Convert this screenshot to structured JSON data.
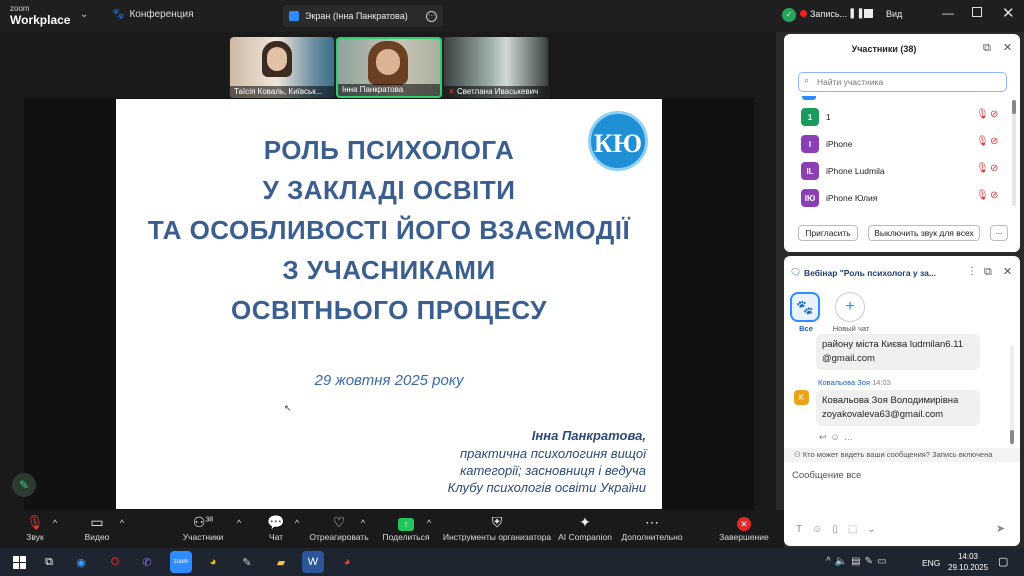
{
  "app": {
    "logo_small": "zoom",
    "logo_big": "Workplace",
    "conference_label": "Конференция",
    "screen_share_label": "Экран (Інна Панкратова)",
    "record_label": "Запись...",
    "view_label": "Вид"
  },
  "videos": [
    {
      "name": "Таїсія Коваль, Київськ..."
    },
    {
      "name": "Інна Панкратова"
    },
    {
      "name": "Светлана Иваськевич"
    }
  ],
  "slide": {
    "title_lines": [
      "РОЛЬ ПСИХОЛОГА",
      "У ЗАКЛАДІ ОСВІТИ",
      "ТА ОСОБЛИВОСТІ ЙОГО ВЗАЄМОДІЇ",
      "З УЧАСНИКАМИ",
      "ОСВІТНЬОГО ПРОЦЕСУ"
    ],
    "logo_text": "КЮ",
    "date": "29 жовтня 2025 року",
    "author_name": "Інна Панкратова,",
    "author_lines": [
      "практична психологиня вищої",
      "категорії; засновниця і ведуча",
      "Клубу психологів освіти України"
    ]
  },
  "participants": {
    "title": "Участники (38)",
    "search_placeholder": "Найти участника",
    "items": [
      {
        "initials": "1",
        "name": "1",
        "color": "#1a9b5b"
      },
      {
        "initials": "I",
        "name": "iPhone",
        "color": "#8b3fb5"
      },
      {
        "initials": "IL",
        "name": "iPhone Ludmila",
        "color": "#8b3fb5"
      },
      {
        "initials": "IЮ",
        "name": "iPhone Юлия",
        "color": "#8b3fb5"
      }
    ],
    "invite_label": "Пригласить",
    "mute_all_label": "Выключить звук для всех",
    "more_label": "..."
  },
  "chat": {
    "title": "Вебінар \"Роль психолога у за...",
    "all_label": "Все",
    "new_chat_label": "Новый чат",
    "messages": [
      {
        "sender": "",
        "time": "",
        "text1": "району міста Києва ludmilan6.11",
        "text2": "@gmail.com"
      },
      {
        "sender": "Ковальова Зоя",
        "time": "14:03",
        "initial": "K",
        "text1": "Ковальова Зоя Володимирівна",
        "text2": "zoyakovaleva63@gmail.com"
      }
    ],
    "visibility_note": "Кто может видеть ваши сообщения? Запись включена",
    "input_placeholder": "Сообщение все"
  },
  "toolbar": {
    "audio": "Звук",
    "video": "Видео",
    "participants": "Участники",
    "participants_count": "38",
    "chat": "Чат",
    "react": "Отреагировать",
    "share": "Поделиться",
    "host_tools": "Инструменты организатора",
    "ai": "AI Companion",
    "more": "Дополнительно",
    "end": "Завершение"
  },
  "taskbar": {
    "lang": "ENG",
    "time": "14:03",
    "date": "29.10.2025"
  }
}
